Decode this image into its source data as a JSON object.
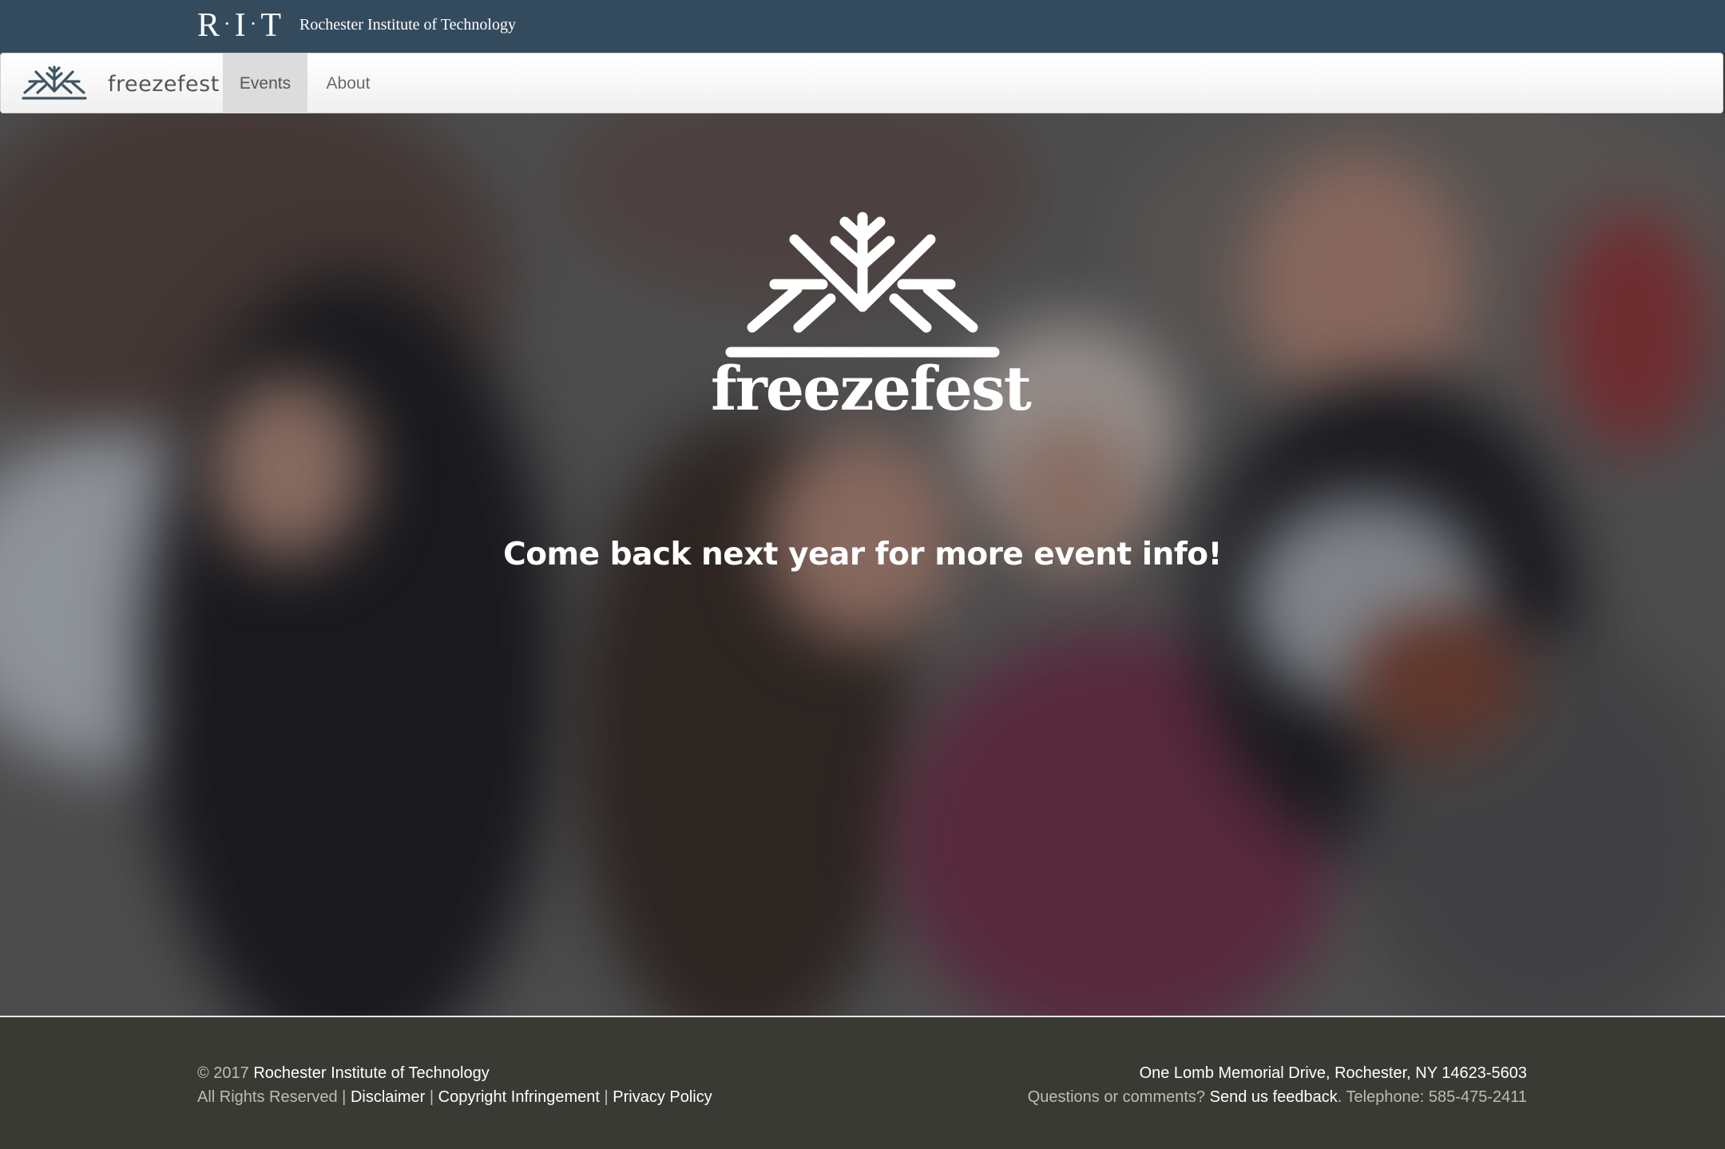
{
  "rit_bar": {
    "logo_letters": [
      "R",
      "I",
      "T"
    ],
    "logo_dot": "·",
    "institution_name": "Rochester Institute of Technology",
    "background_color": "#344b5e"
  },
  "navbar": {
    "brand_icon": "snowflake-logo-icon",
    "brand_text": "freezefest",
    "items": [
      {
        "label": "Events",
        "active": true
      },
      {
        "label": "About",
        "active": false
      }
    ]
  },
  "hero": {
    "logo_icon": "snowflake-icon",
    "logo_text": "freezefest",
    "message": "Come back next year for more event info!"
  },
  "footer": {
    "copyright_prefix": "© 2017",
    "copyright_link": "Rochester Institute of Technology",
    "rights_text": "All Rights Reserved |",
    "links": [
      "Disclaimer",
      "Copyright Infringement",
      "Privacy Policy"
    ],
    "separator": "|",
    "address": "One Lomb Memorial Drive, Rochester, NY 14623-5603",
    "questions_text": "Questions or comments?",
    "feedback_link": "Send us feedback",
    "telephone_text": ". Telephone: 585-475-2411",
    "background_color": "#3a3a34"
  }
}
